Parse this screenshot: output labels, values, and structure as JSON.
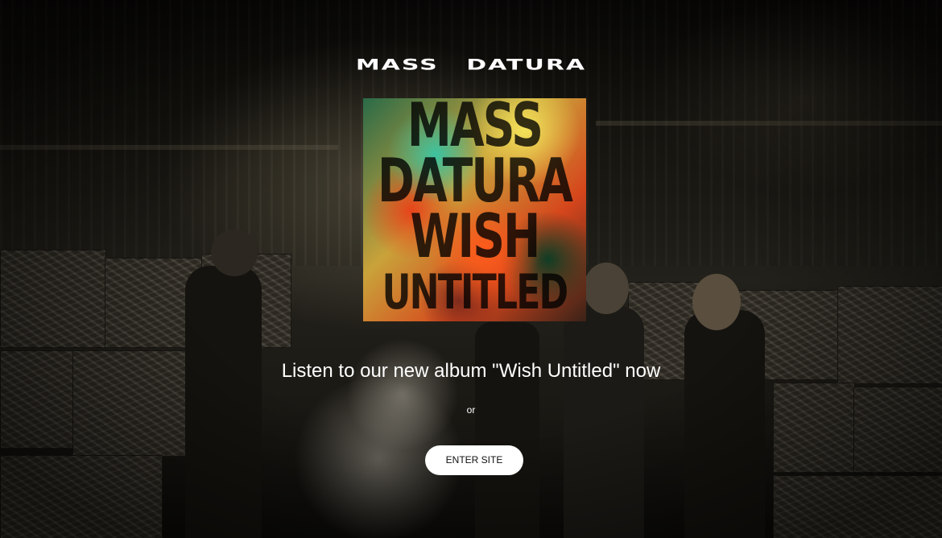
{
  "header": {
    "brand_name": "MASS DATURA"
  },
  "album_cover": {
    "lines": [
      "MASS",
      "DATURA",
      "WISH",
      "UNTITLED"
    ]
  },
  "main": {
    "headline": "Listen to our new album \"Wish Untitled\" now",
    "separator": "or",
    "enter_button_label": "ENTER SITE"
  },
  "colors": {
    "text": "#ffffff",
    "button_bg": "#ffffff",
    "button_text": "#111111"
  }
}
